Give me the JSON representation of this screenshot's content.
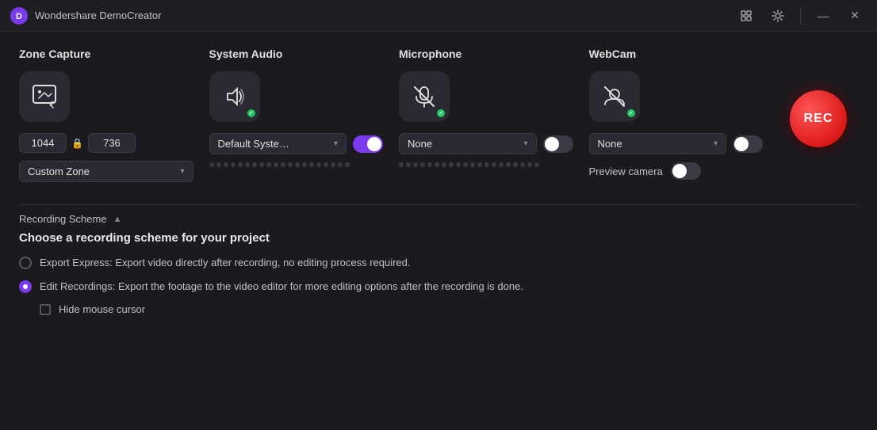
{
  "app": {
    "title": "Wondershare DemoCreator"
  },
  "titlebar": {
    "settings_btn": "⚙",
    "minimize_label": "—",
    "close_label": "✕"
  },
  "zone_capture": {
    "title": "Zone Capture",
    "width": "1044",
    "height": "736",
    "zone_label": "Custom Zone",
    "zone_dropdown_arrow": "▾"
  },
  "system_audio": {
    "title": "System Audio",
    "dropdown_value": "Default Syste…",
    "dropdown_arrow": "▾",
    "toggle_state": "on",
    "level_dots": 20
  },
  "microphone": {
    "title": "Microphone",
    "dropdown_value": "None",
    "dropdown_arrow": "▾",
    "toggle_state": "off",
    "level_dots": 20
  },
  "webcam": {
    "title": "WebCam",
    "dropdown_value": "None",
    "dropdown_arrow": "▾",
    "toggle_state": "off",
    "preview_camera_label": "Preview camera"
  },
  "rec_button": {
    "label": "REC"
  },
  "recording_scheme": {
    "section_label": "Recording Scheme",
    "section_arrow": "▲",
    "title": "Choose a recording scheme for your project",
    "options": [
      {
        "id": "export_express",
        "label": "Export Express: Export video directly after recording, no editing process required.",
        "selected": false
      },
      {
        "id": "edit_recordings",
        "label": "Edit Recordings: Export the footage to the video editor for more editing options after the recording is done.",
        "selected": true
      }
    ],
    "hide_cursor_label": "Hide mouse cursor"
  }
}
